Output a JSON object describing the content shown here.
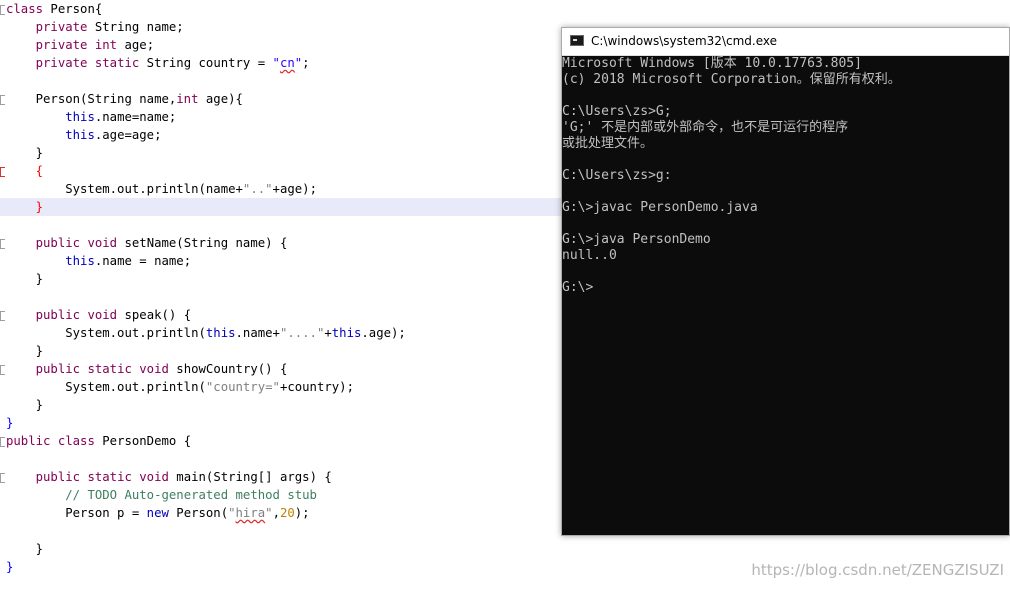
{
  "editor": {
    "lines": [
      {
        "t": "class Person{"
      },
      {
        "t": "    private String name;"
      },
      {
        "t": "    private int age;"
      },
      {
        "t": "    private static String country = \"cn\";"
      },
      {
        "t": ""
      },
      {
        "t": "    Person(String name,int age){"
      },
      {
        "t": "        this.name=name;"
      },
      {
        "t": "        this.age=age;"
      },
      {
        "t": "    }"
      },
      {
        "t": "    {"
      },
      {
        "t": "        System.out.println(name+\"..\"+age);"
      },
      {
        "t": "    }"
      },
      {
        "t": ""
      },
      {
        "t": "    public void setName(String name) {"
      },
      {
        "t": "        this.name = name;"
      },
      {
        "t": "    }"
      },
      {
        "t": ""
      },
      {
        "t": "    public void speak() {"
      },
      {
        "t": "        System.out.println(this.name+\"....\"+this.age);"
      },
      {
        "t": "    }"
      },
      {
        "t": "    public static void showCountry() {"
      },
      {
        "t": "        System.out.println(\"country=\"+country);"
      },
      {
        "t": "    }"
      },
      {
        "t": "}"
      },
      {
        "t": "public class PersonDemo {"
      },
      {
        "t": ""
      },
      {
        "t": "    public static void main(String[] args) {"
      },
      {
        "t": "        // TODO Auto-generated method stub"
      },
      {
        "t": "        Person p = new Person(\"hira\",20);"
      },
      {
        "t": ""
      },
      {
        "t": "    }"
      },
      {
        "t": "}"
      }
    ]
  },
  "cmd": {
    "title": "C:\\windows\\system32\\cmd.exe",
    "lines": [
      "Microsoft Windows [版本 10.0.17763.805]",
      "(c) 2018 Microsoft Corporation。保留所有权利。",
      "",
      "C:\\Users\\zs>G;",
      "'G;' 不是内部或外部命令，也不是可运行的程序",
      "或批处理文件。",
      "",
      "C:\\Users\\zs>g:",
      "",
      "G:\\>javac PersonDemo.java",
      "",
      "G:\\>java PersonDemo",
      "null..0",
      "",
      "G:\\>"
    ]
  },
  "watermark": "https://blog.csdn.net/ZENGZISUZI"
}
